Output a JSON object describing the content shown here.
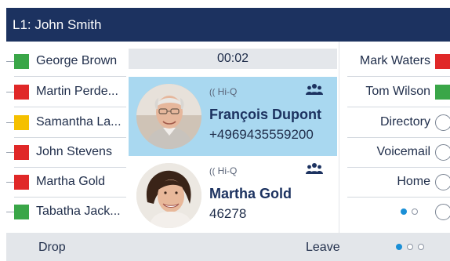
{
  "title_bar": {
    "line_label": "L1: John Smith"
  },
  "left_keys": [
    {
      "name": "George Brown",
      "status_color": "#3aa648"
    },
    {
      "name": "Martin Perde...",
      "status_color": "#e02828"
    },
    {
      "name": "Samantha La...",
      "status_color": "#f5c000"
    },
    {
      "name": "John Stevens",
      "status_color": "#e02828"
    },
    {
      "name": "Martha Gold",
      "status_color": "#e02828"
    },
    {
      "name": "Tabatha Jack...",
      "status_color": "#3aa648"
    }
  ],
  "call_timer": "00:02",
  "calls": [
    {
      "audio_badge": "Hi-Q",
      "name": "François Dupont",
      "number": "+4969435559200",
      "active": true,
      "icons": [
        "hiq-audio-icon",
        "conference-group-icon"
      ]
    },
    {
      "audio_badge": "Hi-Q",
      "name": "Martha Gold",
      "number": "46278",
      "active": false,
      "icons": [
        "hiq-audio-icon",
        "conference-group-icon"
      ]
    }
  ],
  "right_keys": [
    {
      "name": "Mark Waters",
      "status_color": "#e02828"
    },
    {
      "name": "Tom Wilson",
      "status_color": "#3aa648"
    },
    {
      "name": "Directory",
      "status_color": null
    },
    {
      "name": "Voicemail",
      "status_color": null
    },
    {
      "name": "Home",
      "status_color": null
    }
  ],
  "right_page_indicator": {
    "current": 1,
    "total": 2
  },
  "softkeys": {
    "key1": "Drop",
    "key3": "Leave"
  },
  "softkey_page_indicator": {
    "current": 1,
    "total": 3
  },
  "colors": {
    "title_bar": "#1c3260",
    "active_call": "#a9d8f0",
    "accent": "#1a8fd6"
  }
}
